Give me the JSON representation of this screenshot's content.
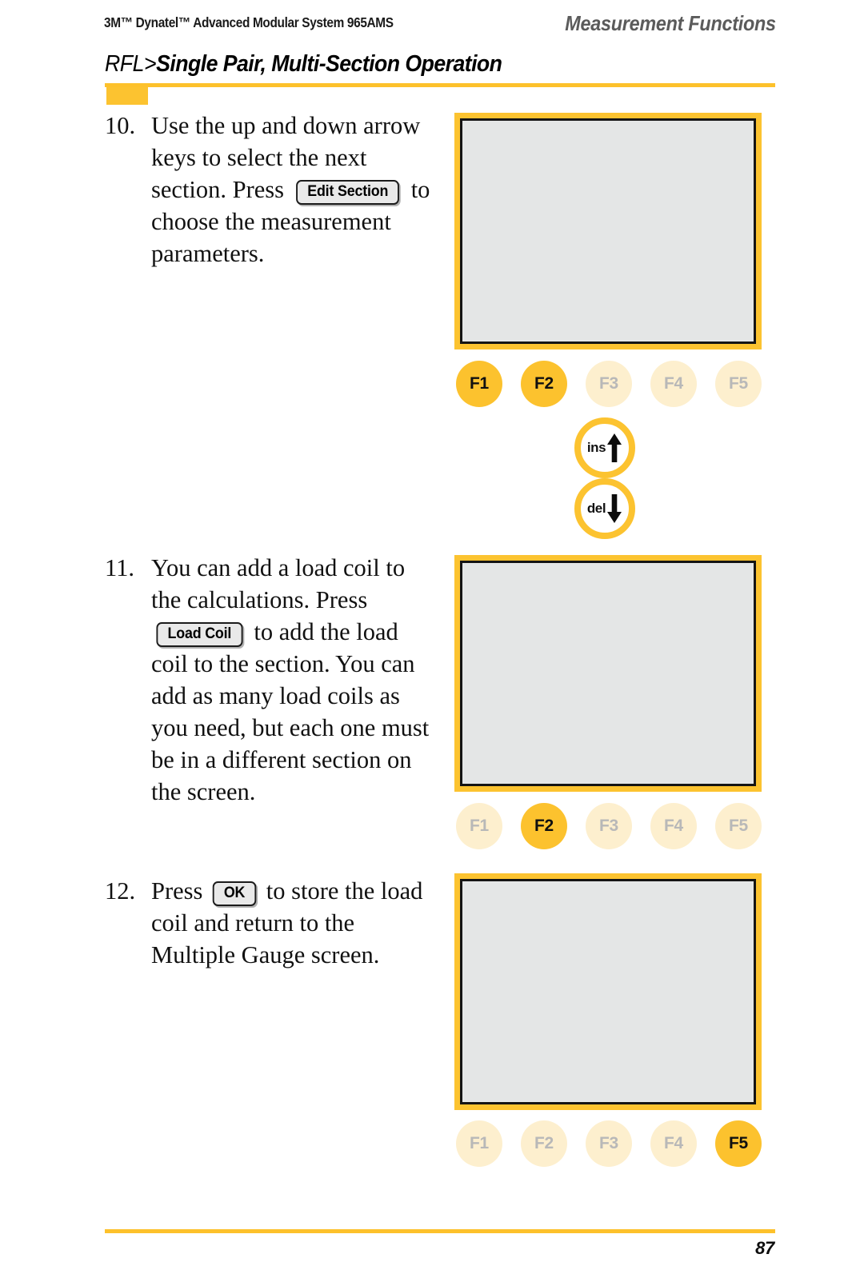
{
  "header": {
    "product_line": "3M™ Dynatel™ Advanced Modular System 965AMS",
    "section_title": "Measurement Functions"
  },
  "title": {
    "prefix": "RFL>",
    "main": "Single Pair, Multi-Section Operation"
  },
  "steps": [
    {
      "number": "10.",
      "text_before": "Use the up and down arrow keys to select the next section. Press",
      "softkey": "Edit Section",
      "text_after": "to choose the measurement parameters."
    },
    {
      "number": "11.",
      "text_before": "You can add a load coil to the calculations. Press",
      "softkey": "Load Coil",
      "text_after": "to add the load coil to the section. You can add as many load coils as you need, but each one must be in a different section on the screen."
    },
    {
      "number": "12.",
      "text_before": "Press",
      "softkey": "OK",
      "text_after": "to store the load coil and return to the Multiple Gauge screen."
    }
  ],
  "devices": [
    {
      "screen_content": "",
      "fkeys": [
        {
          "label": "F1",
          "active": true
        },
        {
          "label": "F2",
          "active": true
        },
        {
          "label": "F3",
          "active": false
        },
        {
          "label": "F4",
          "active": false
        },
        {
          "label": "F5",
          "active": false
        }
      ],
      "arrow_keys": [
        {
          "label": "ins",
          "direction": "up"
        },
        {
          "label": "del",
          "direction": "down"
        }
      ]
    },
    {
      "screen_content": "",
      "fkeys": [
        {
          "label": "F1",
          "active": false
        },
        {
          "label": "F2",
          "active": true
        },
        {
          "label": "F3",
          "active": false
        },
        {
          "label": "F4",
          "active": false
        },
        {
          "label": "F5",
          "active": false
        }
      ],
      "arrow_keys": []
    },
    {
      "screen_content": "",
      "fkeys": [
        {
          "label": "F1",
          "active": false
        },
        {
          "label": "F2",
          "active": false
        },
        {
          "label": "F3",
          "active": false
        },
        {
          "label": "F4",
          "active": false
        },
        {
          "label": "F5",
          "active": true
        }
      ],
      "arrow_keys": []
    }
  ],
  "footer": {
    "page_number": "87"
  },
  "colors": {
    "accent_yellow": "#FDC12B",
    "key_active": "#FCC22E",
    "key_inactive": "#FDEFCE",
    "lcd_background": "#e4e6e6",
    "header_gray": "#5b5b5b"
  }
}
